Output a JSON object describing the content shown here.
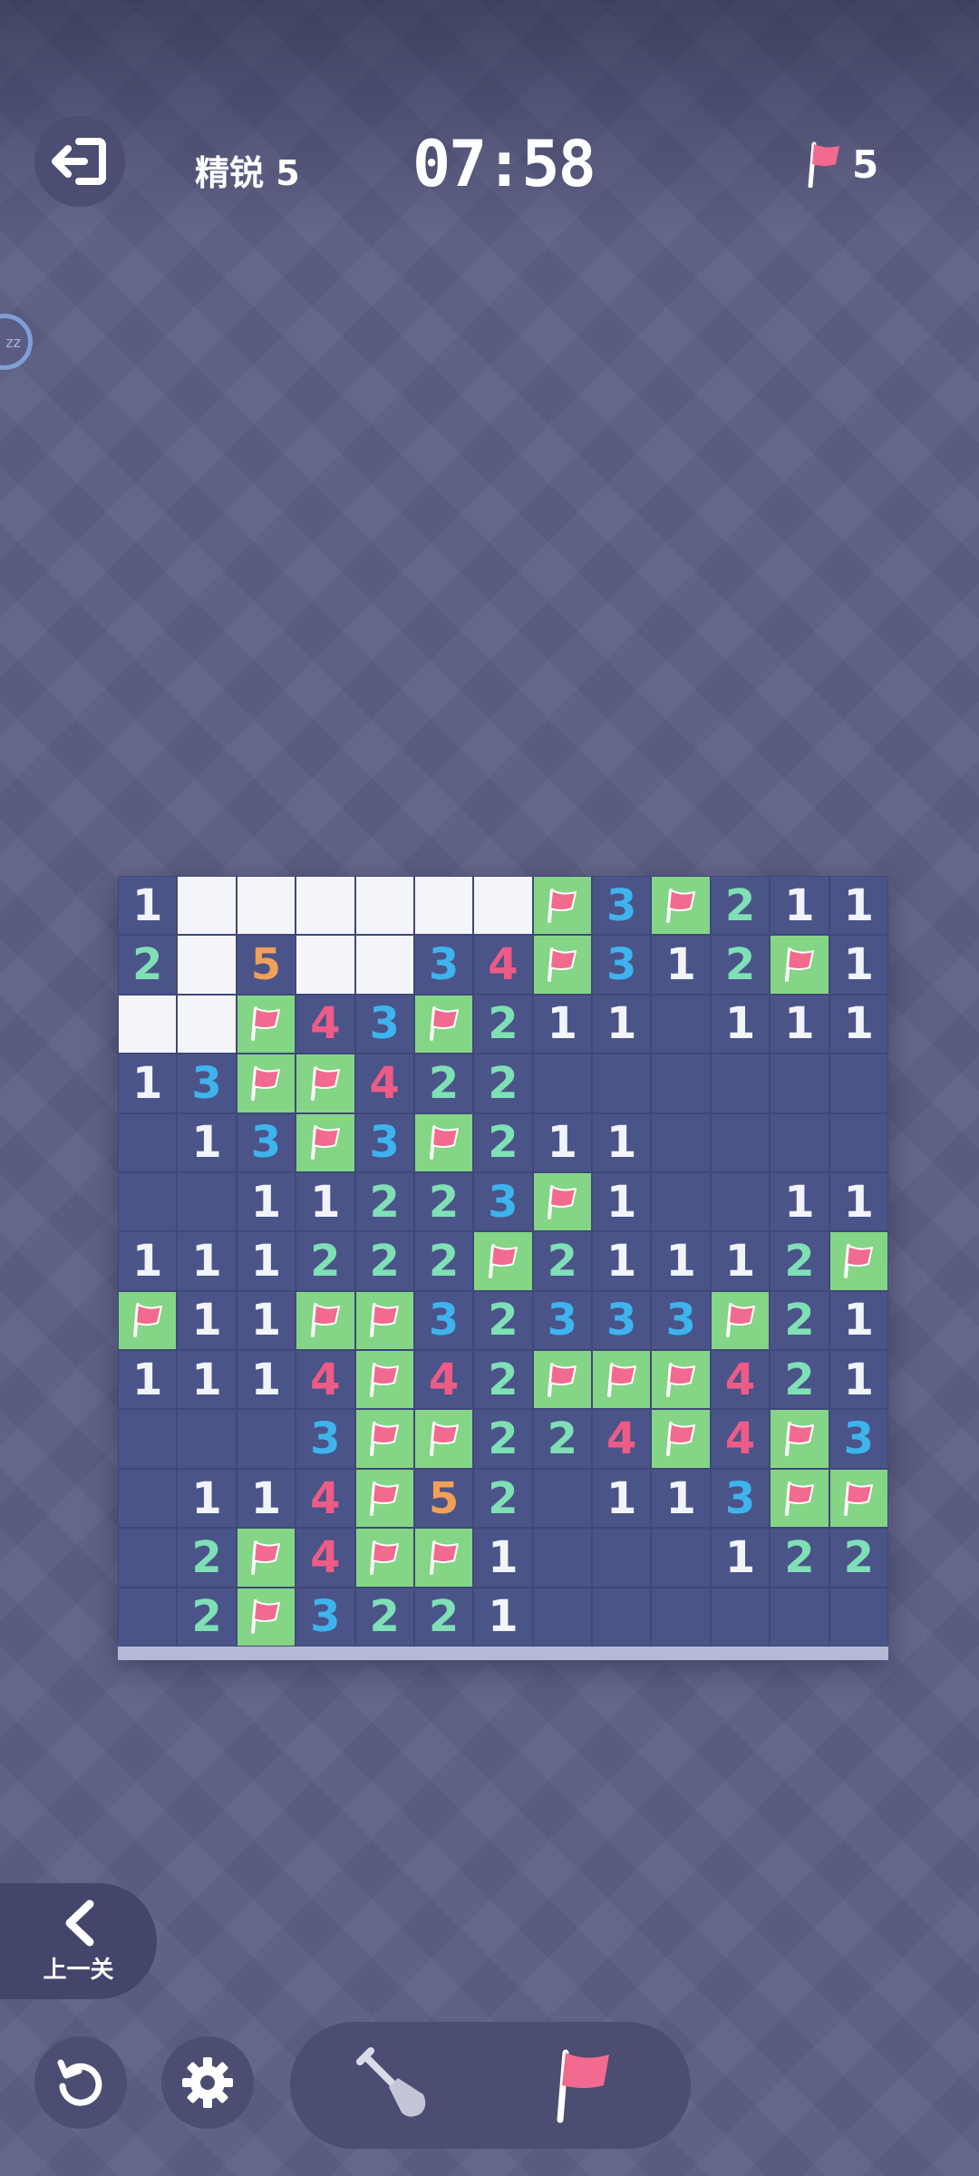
{
  "header": {
    "level": "精锐 5",
    "timer": "07:58",
    "flags_left": "5"
  },
  "footer": {
    "prev_level_label": "上一关"
  },
  "colors": {
    "flag_cell": "#84d585",
    "open_cell": "#4a5488",
    "flag": "#f26b8f"
  },
  "board": {
    "rows": 13,
    "cols": 13,
    "cells": [
      [
        "1",
        "?",
        "?",
        "?",
        "?",
        "?",
        "?",
        "F",
        "3",
        "F",
        "2",
        "1",
        "1"
      ],
      [
        "2",
        "?",
        "5",
        "?",
        "?",
        "3",
        "4",
        "F",
        "3",
        "1",
        "2",
        "F",
        "1"
      ],
      [
        "?",
        "?",
        "F",
        "4",
        "3",
        "F",
        "2",
        "1",
        "1",
        "",
        "1",
        "1",
        "1"
      ],
      [
        "1",
        "3",
        "F",
        "F",
        "4",
        "2",
        "2",
        "",
        "",
        "",
        "",
        "",
        ""
      ],
      [
        "",
        "1",
        "3",
        "F",
        "3",
        "F",
        "2",
        "1",
        "1",
        "",
        "",
        "",
        ""
      ],
      [
        "",
        "",
        "1",
        "1",
        "2",
        "2",
        "3",
        "F",
        "1",
        "",
        "",
        "1",
        "1"
      ],
      [
        "1",
        "1",
        "1",
        "2",
        "2",
        "2",
        "F",
        "2",
        "1",
        "1",
        "1",
        "2",
        "F"
      ],
      [
        "F",
        "1",
        "1",
        "F",
        "F",
        "3",
        "2",
        "3",
        "3",
        "3",
        "F",
        "2",
        "1"
      ],
      [
        "1",
        "1",
        "1",
        "4",
        "F",
        "4",
        "2",
        "F",
        "F",
        "F",
        "4",
        "2",
        "1"
      ],
      [
        "",
        "",
        "",
        "3",
        "F",
        "F",
        "2",
        "2",
        "4",
        "F",
        "4",
        "F",
        "3"
      ],
      [
        "",
        "1",
        "1",
        "4",
        "F",
        "5",
        "2",
        "",
        "1",
        "1",
        "3",
        "F",
        "F"
      ],
      [
        "",
        "2",
        "F",
        "4",
        "F",
        "F",
        "1",
        "",
        "",
        "",
        "1",
        "2",
        "2"
      ],
      [
        "",
        "2",
        "F",
        "3",
        "2",
        "2",
        "1",
        "",
        "",
        "",
        "",
        "",
        ""
      ]
    ]
  }
}
